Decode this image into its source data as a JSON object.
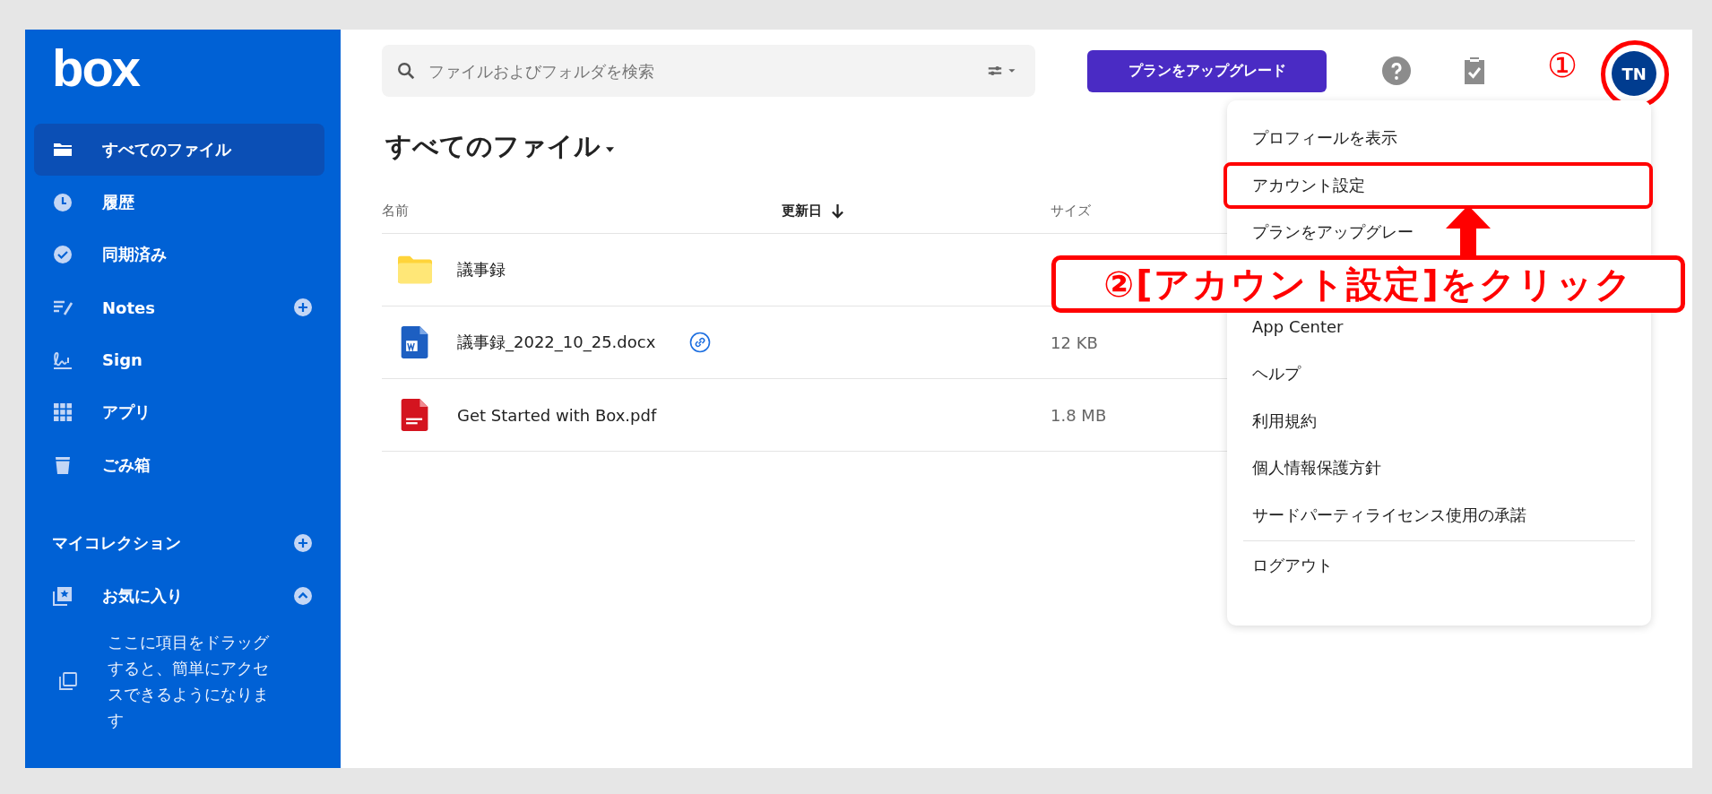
{
  "sidebar": {
    "logo": "box",
    "items": [
      {
        "label": "すべてのファイル",
        "selected": true,
        "add": false
      },
      {
        "label": "履歴",
        "selected": false,
        "add": false
      },
      {
        "label": "同期済み",
        "selected": false,
        "add": false
      },
      {
        "label": "Notes",
        "selected": false,
        "add": true
      },
      {
        "label": "Sign",
        "selected": false,
        "add": false
      },
      {
        "label": "アプリ",
        "selected": false,
        "add": false
      },
      {
        "label": "ごみ箱",
        "selected": false,
        "add": false
      }
    ],
    "collections": {
      "title": "マイコレクション",
      "favorites": {
        "label": "お気に入り",
        "expanded": true
      },
      "hint": "ここに項目をドラッグすると、簡単にアクセスできるようになります"
    }
  },
  "search": {
    "placeholder": "ファイルおよびフォルダを検索"
  },
  "upgrade_button": "プランをアップグレード",
  "avatar": {
    "initials": "TN"
  },
  "folder_title": "すべてのファイル",
  "table": {
    "columns": [
      {
        "label": "名前",
        "sorted": false
      },
      {
        "label": "更新日",
        "sorted": true
      },
      {
        "label": "サイズ",
        "sorted": false
      }
    ],
    "rows": [
      {
        "kind": "folder",
        "name": "議事録",
        "shared": false
      },
      {
        "kind": "word",
        "name": "議事録_2022_10_25.docx",
        "shared": true,
        "size": "12 KB"
      },
      {
        "kind": "pdf",
        "name": "Get Started with Box.pdf",
        "shared": false,
        "size": "1.8 MB"
      }
    ]
  },
  "menu": {
    "items_top": [
      {
        "label": "プロフィールを表示",
        "highlighted": false
      },
      {
        "label": "アカウント設定",
        "highlighted": true
      },
      {
        "label": "プランをアップグレー",
        "highlighted": false
      }
    ],
    "items_bottom": [
      {
        "label": "App Center",
        "highlighted": false
      },
      {
        "label": "ヘルプ",
        "highlighted": false
      },
      {
        "label": "利用規約",
        "highlighted": false
      },
      {
        "label": "個人情報保護方針",
        "highlighted": false
      },
      {
        "label": "サードパーティライセンス使用の承諾",
        "highlighted": false
      }
    ],
    "logout": "ログアウト"
  },
  "annotations": {
    "step1": "①",
    "step2": "②[アカウント設定]をクリック"
  }
}
